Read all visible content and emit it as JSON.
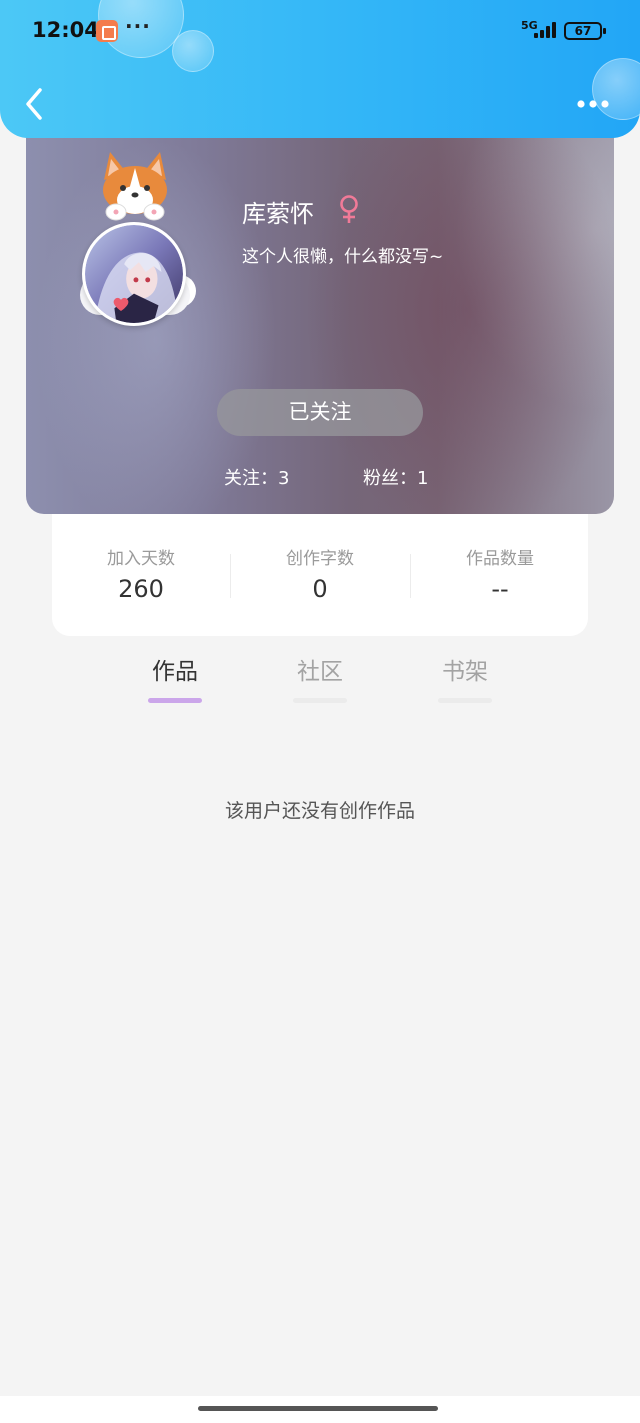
{
  "status_bar": {
    "time": "12:04",
    "more": "···",
    "network": "5G",
    "battery": "67"
  },
  "header": {
    "back_icon": "chevron-left-icon",
    "more_icon": "more-horizontal-icon"
  },
  "profile": {
    "name": "库萦怀",
    "gender_icon": "female-symbol-icon",
    "gender_color": "#f07a98",
    "bio": "这个人很懒，什么都没写~",
    "follow_button": "已关注",
    "following": "关注：3",
    "fans": "粉丝：1"
  },
  "stats": [
    {
      "label": "加入天数",
      "value": "260"
    },
    {
      "label": "创作字数",
      "value": "0"
    },
    {
      "label": "作品数量",
      "value": "--"
    }
  ],
  "tabs": [
    {
      "label": "作品",
      "active": true
    },
    {
      "label": "社区",
      "active": false
    },
    {
      "label": "书架",
      "active": false
    }
  ],
  "empty_message": "该用户还没有创作作品",
  "colors": {
    "header_gradient_start": "#4cc8f6",
    "header_gradient_end": "#22a6f6",
    "tab_indicator": "#cba6ea",
    "page_background": "#f4f4f4"
  }
}
